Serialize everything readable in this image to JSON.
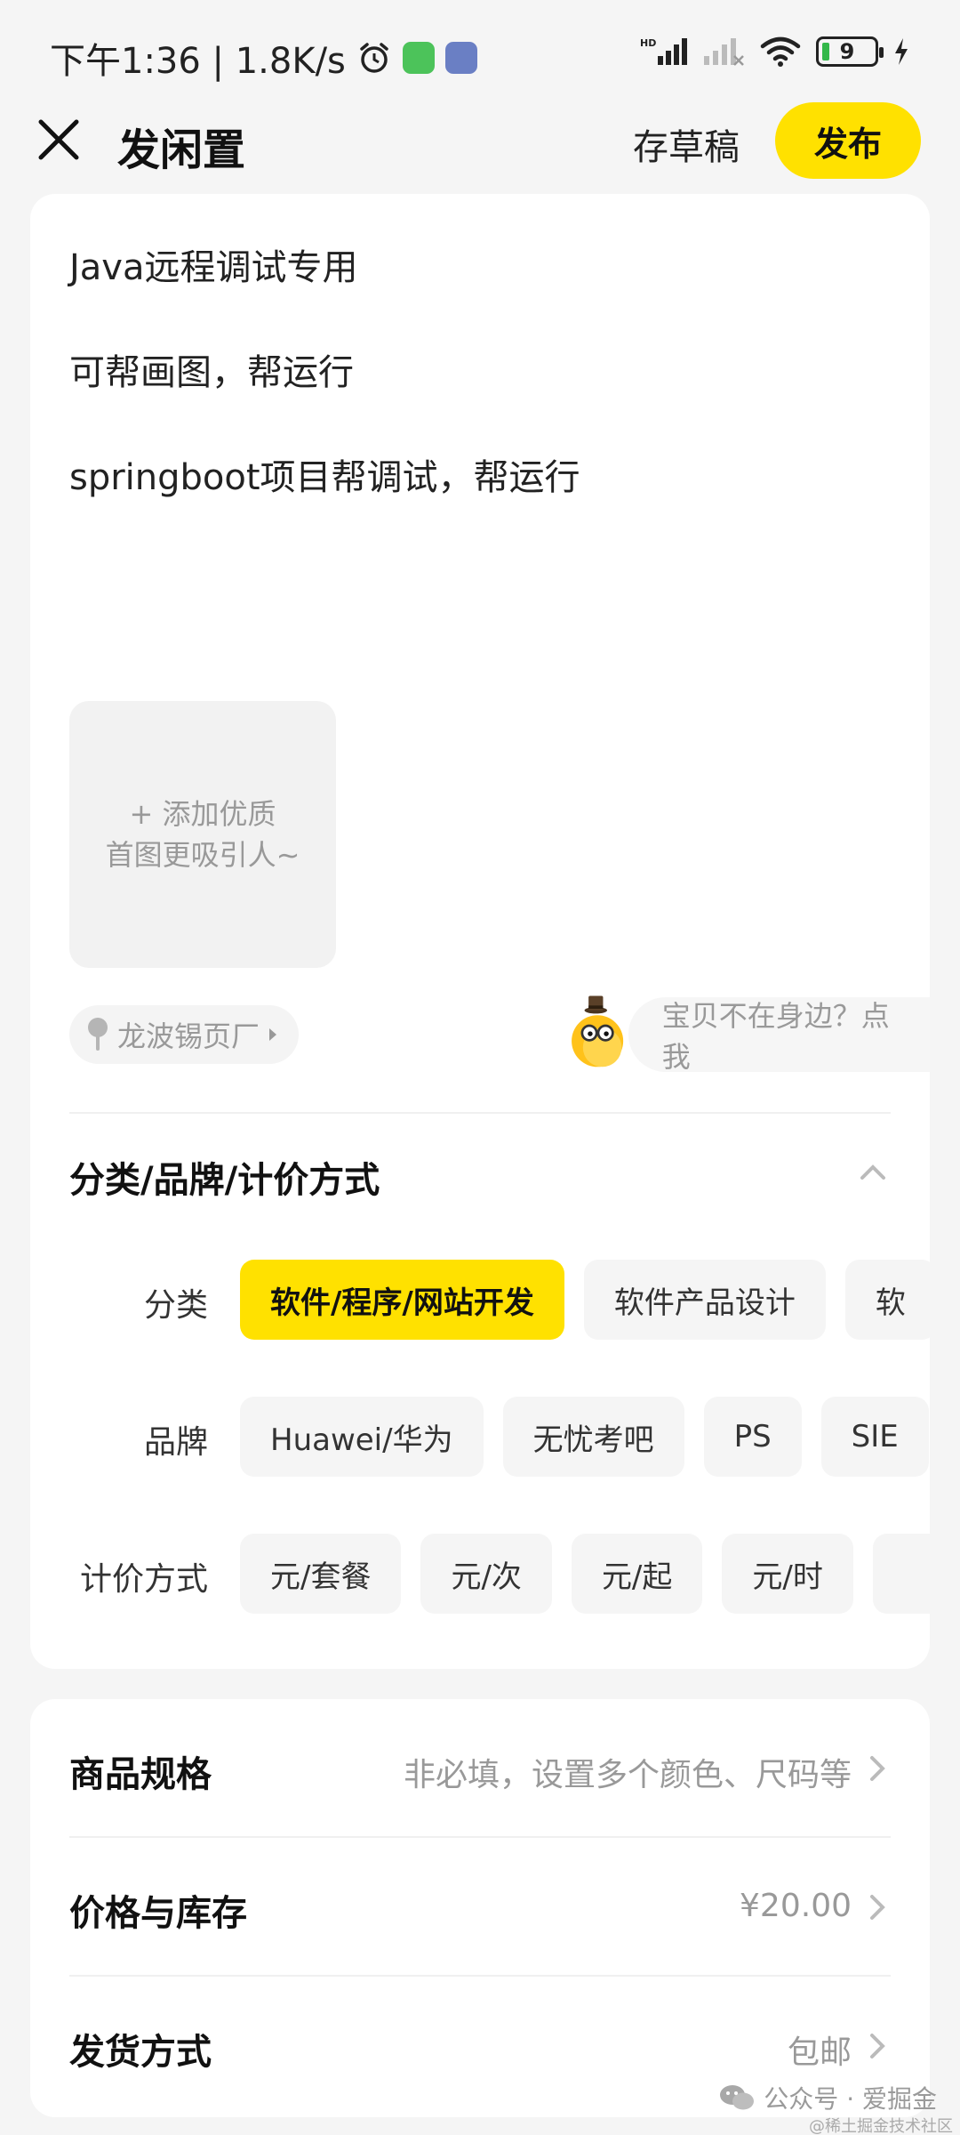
{
  "status_bar": {
    "time_speed": "下午1:36 | 1.8K/s",
    "battery": "9",
    "signal_label": "HD"
  },
  "header": {
    "title": "发闲置",
    "draft_label": "存草稿",
    "publish_label": "发布",
    "accent_color": "#ffe100"
  },
  "description": {
    "lines": [
      "Java远程调试专用",
      "可帮画图，帮运行",
      "springboot项目帮调试，帮运行"
    ]
  },
  "photo": {
    "line1": "+ 添加优质",
    "line2": "首图更吸引人~"
  },
  "location": {
    "label": "龙波锡页厂"
  },
  "helper": {
    "label": "宝贝不在身边？点我"
  },
  "category_section": {
    "title": "分类/品牌/计价方式",
    "rows": [
      {
        "label": "分类",
        "options": [
          "软件/程序/网站开发",
          "软件产品设计",
          "软"
        ],
        "selected": 0
      },
      {
        "label": "品牌",
        "options": [
          "Huawei/华为",
          "无忧考吧",
          "PS",
          "SIE"
        ],
        "selected": -1
      },
      {
        "label": "计价方式",
        "options": [
          "元/套餐",
          "元/次",
          "元/起",
          "元/时",
          ""
        ],
        "selected": -1
      }
    ]
  },
  "specs": [
    {
      "label": "商品规格",
      "value": "非必填，设置多个颜色、尺码等"
    },
    {
      "label": "价格与库存",
      "value": "¥20.00"
    },
    {
      "label": "发货方式",
      "value": "包邮"
    }
  ],
  "watermark": {
    "text": "公众号 · 爱掘金",
    "sub": "@稀土掘金技术社区"
  }
}
